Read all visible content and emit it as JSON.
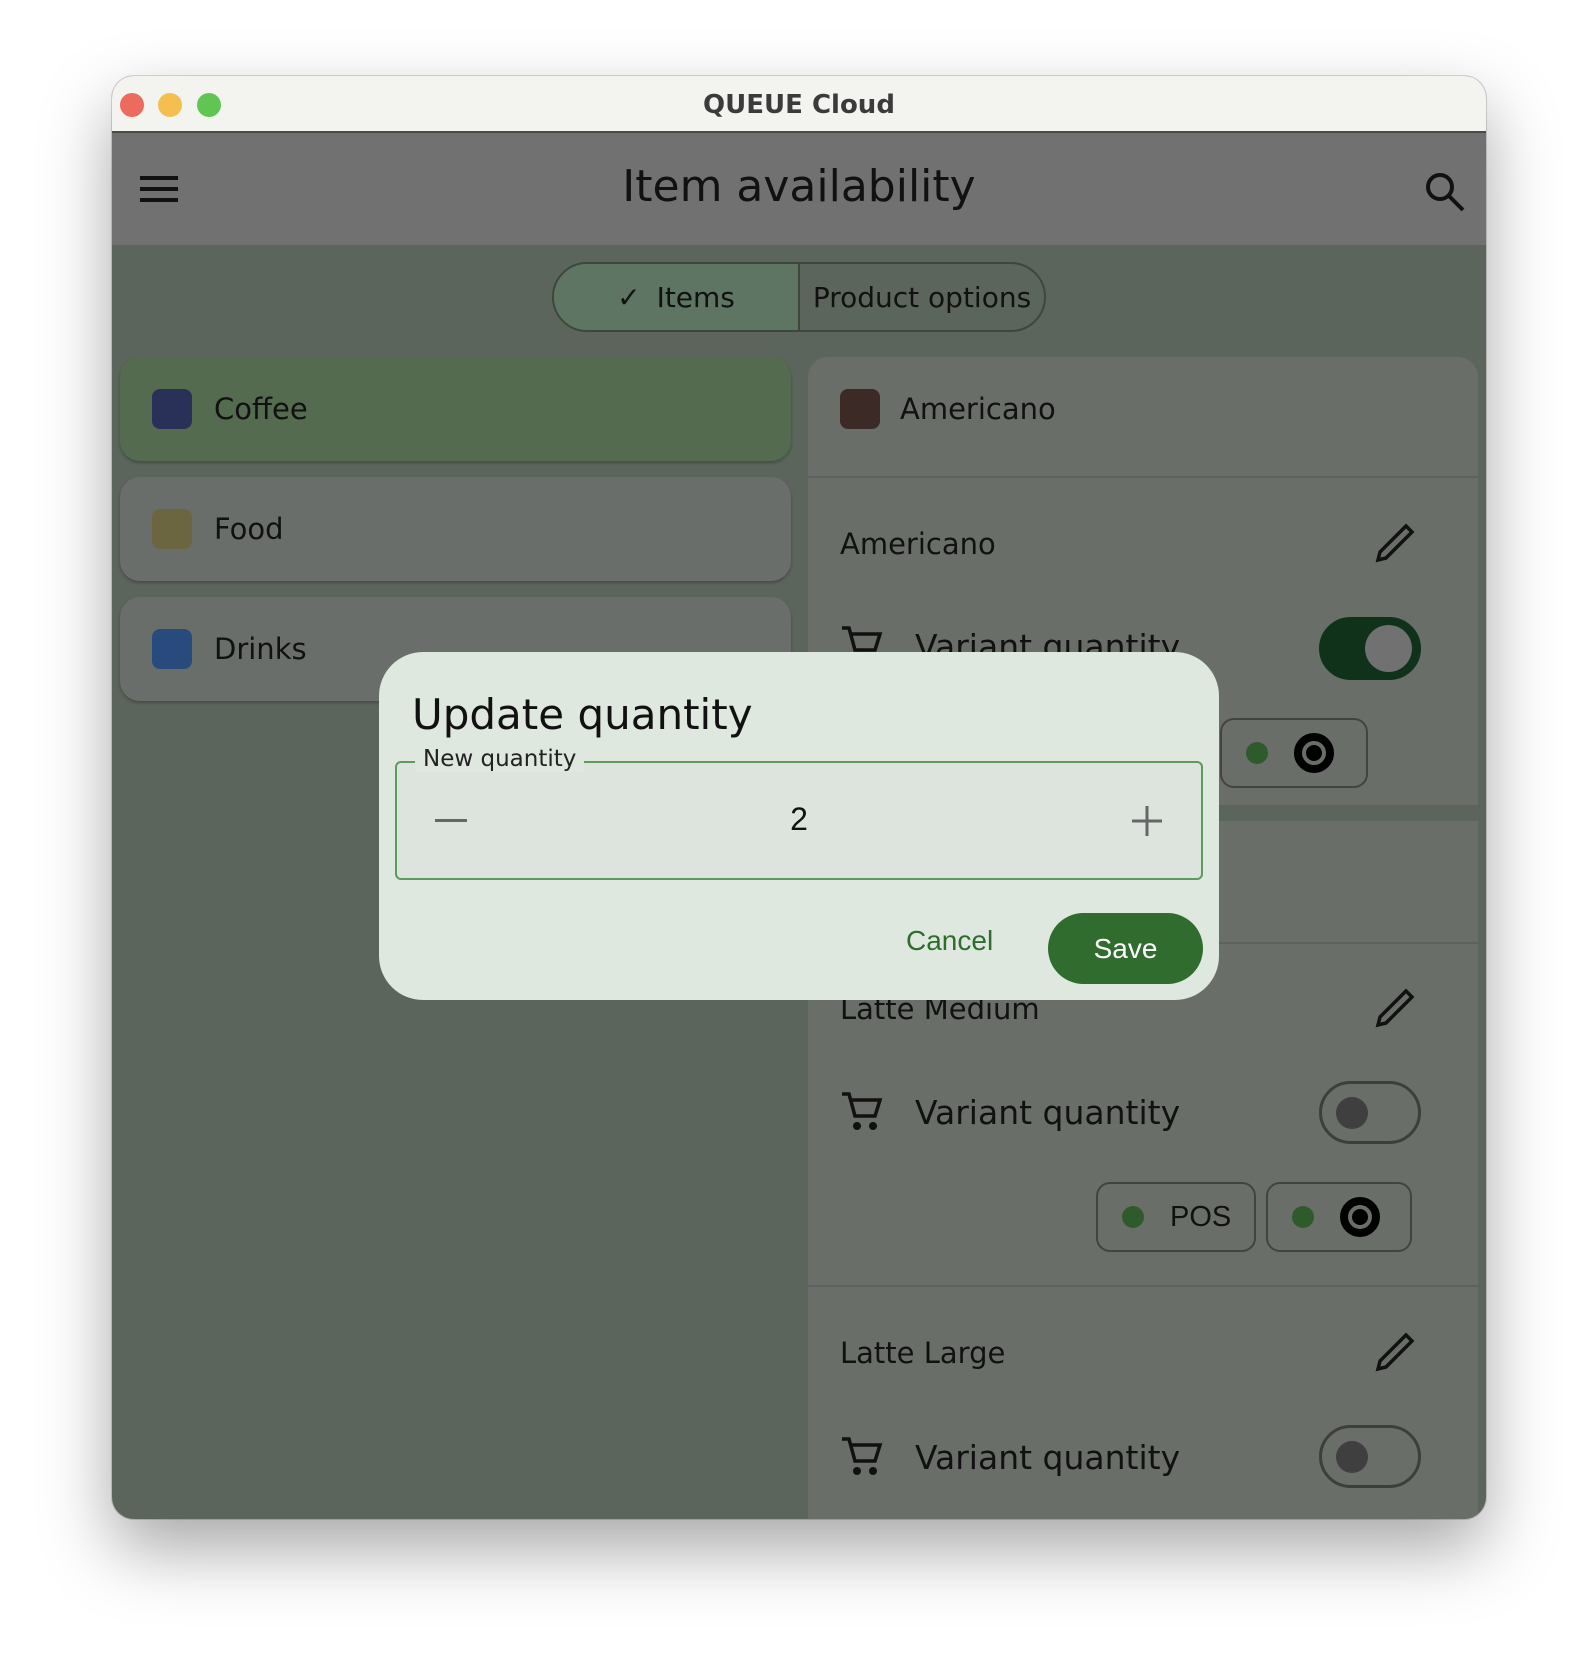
{
  "window": {
    "title": "QUEUE Cloud",
    "controls": {
      "close": "#ec6a5e",
      "minimize": "#f4bf4f",
      "zoom": "#61c554"
    }
  },
  "appbar": {
    "title": "Item availability",
    "menu_icon": "hamburger-icon",
    "search_icon": "search-icon"
  },
  "tabs": [
    {
      "label": "Items",
      "selected": true
    },
    {
      "label": "Product options",
      "selected": false
    }
  ],
  "categories": [
    {
      "label": "Coffee",
      "color": "#2a3158",
      "selected": true
    },
    {
      "label": "Food",
      "color": "#6b6540",
      "selected": false
    },
    {
      "label": "Drinks",
      "color": "#284a7c",
      "selected": false
    }
  ],
  "detail": {
    "header": {
      "label": "Americano",
      "color": "#3b2a26"
    },
    "variants": [
      {
        "name": "Americano",
        "quantity_label": "Variant quantity",
        "enabled": true
      },
      {
        "name": "Latte Medium",
        "quantity_label": "Variant quantity",
        "enabled": false,
        "chips": [
          {
            "label": "POS"
          },
          {
            "label": ""
          }
        ]
      },
      {
        "name": "Latte Large",
        "quantity_label": "Variant quantity",
        "enabled": false
      }
    ]
  },
  "dialog": {
    "title": "Update quantity",
    "field_label": "New quantity",
    "value": "2",
    "cancel": "Cancel",
    "save": "Save",
    "accent": "#2f6c2e"
  }
}
